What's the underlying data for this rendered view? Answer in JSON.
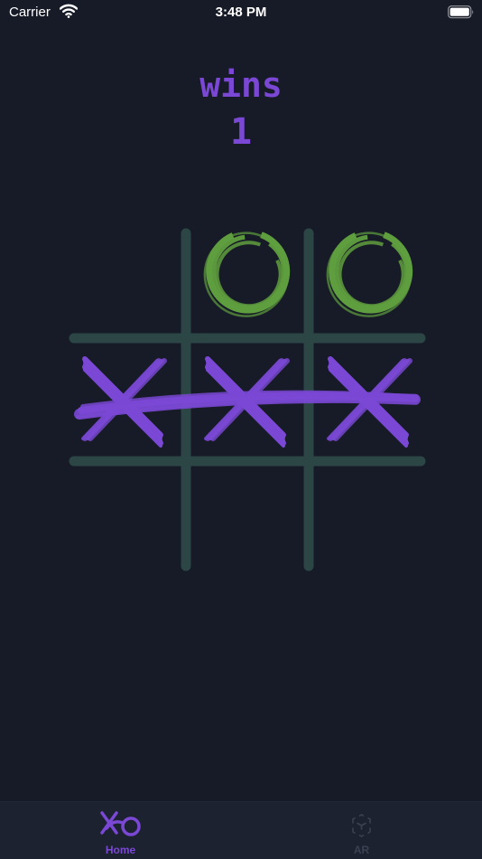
{
  "status_bar": {
    "carrier": "Carrier",
    "time": "3:48 PM",
    "wifi_icon": "wifi-icon",
    "battery_icon": "battery-icon"
  },
  "score": {
    "label": "wins",
    "count": "1"
  },
  "board": {
    "cells": [
      [
        "",
        "O",
        "O"
      ],
      [
        "X",
        "X",
        "X"
      ],
      [
        "",
        "",
        ""
      ]
    ],
    "winning_line": {
      "from": [
        1,
        0
      ],
      "to": [
        1,
        2
      ]
    }
  },
  "tabs": [
    {
      "label": "Home",
      "icon": "xo-logo-icon",
      "active": true
    },
    {
      "label": "AR",
      "icon": "ar-cube-icon",
      "active": false
    }
  ],
  "colors": {
    "background": "#171b27",
    "accent": "#7a48d4",
    "o_mark": "#5f9e3e",
    "grid": "#2b4645",
    "tab_bar": "#1d2230",
    "inactive": "#3b4150"
  }
}
